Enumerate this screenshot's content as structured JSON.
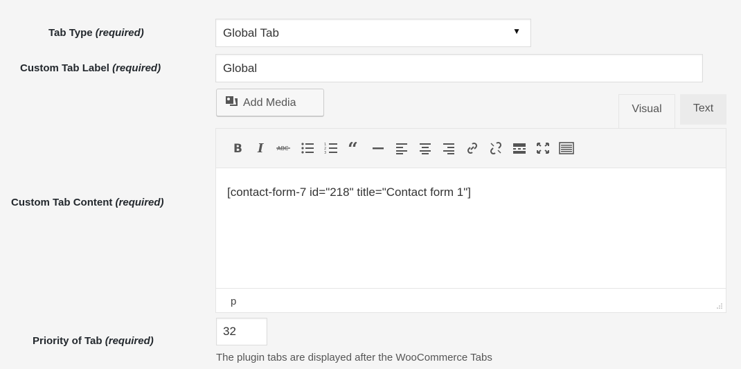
{
  "form": {
    "tab_type": {
      "label": "Tab Type",
      "req": "(required)",
      "value": "Global Tab"
    },
    "tab_label": {
      "label": "Custom Tab Label",
      "req": "(required)",
      "value": "Global"
    },
    "tab_content": {
      "label": "Custom Tab Content",
      "req": "(required)"
    },
    "priority": {
      "label": "Priority of Tab",
      "req": "(required)",
      "value": "32",
      "description": "The plugin tabs are displayed after the WooCommerce Tabs"
    }
  },
  "editor": {
    "add_media": "Add Media",
    "tabs": {
      "visual": "Visual",
      "text": "Text"
    },
    "content": "[contact-form-7 id=\"218\" title=\"Contact form 1\"]",
    "path": "p",
    "toolbar_icons": [
      "bold-icon",
      "italic-icon",
      "strikethrough-icon",
      "bullet-list-icon",
      "numbered-list-icon",
      "blockquote-icon",
      "horizontal-rule-icon",
      "align-left-icon",
      "align-center-icon",
      "align-right-icon",
      "link-icon",
      "unlink-icon",
      "read-more-icon",
      "fullscreen-icon",
      "toolbar-toggle-icon"
    ]
  }
}
